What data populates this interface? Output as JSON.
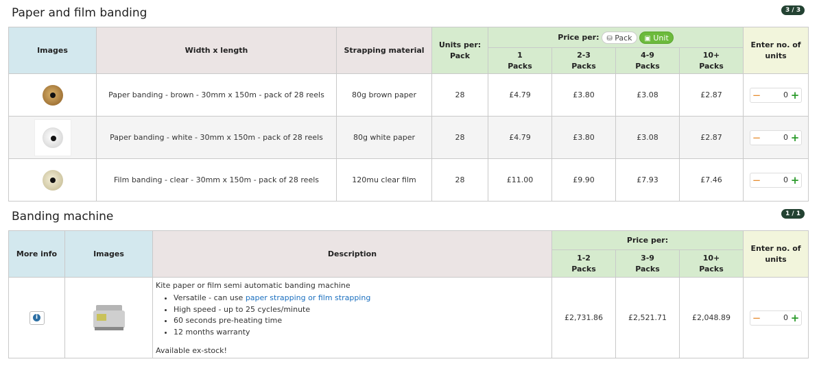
{
  "section1": {
    "title": "Paper and film banding",
    "badge": "3 / 3",
    "headers": {
      "images": "Images",
      "width_length": "Width x length",
      "material": "Strapping material",
      "units_per_pack_1": "Units per:",
      "units_per_pack_2": "Pack",
      "price_per": "Price per:",
      "pack_pill": "Pack",
      "unit_pill": "Unit",
      "tiers": [
        {
          "top": "1",
          "bottom": "Packs"
        },
        {
          "top": "2-3",
          "bottom": "Packs"
        },
        {
          "top": "4-9",
          "bottom": "Packs"
        },
        {
          "top": "10+",
          "bottom": "Packs"
        }
      ],
      "enter_units_1": "Enter no. of",
      "enter_units_2": "units"
    },
    "rows": [
      {
        "image": "brown-reel-image",
        "name": "Paper banding - brown - 30mm x 150m - pack of 28 reels",
        "material": "80g brown paper",
        "units": "28",
        "prices": [
          "£4.79",
          "£3.80",
          "£3.08",
          "£2.87"
        ],
        "qty": "0"
      },
      {
        "image": "white-reel-image",
        "name": "Paper banding - white - 30mm x 150m - pack of 28 reels",
        "material": "80g white paper",
        "units": "28",
        "prices": [
          "£4.79",
          "£3.80",
          "£3.08",
          "£2.87"
        ],
        "qty": "0"
      },
      {
        "image": "clear-reel-image",
        "name": "Film banding - clear - 30mm x 150m - pack of 28 reels",
        "material": "120mu clear film",
        "units": "28",
        "prices": [
          "£11.00",
          "£9.90",
          "£7.93",
          "£7.46"
        ],
        "qty": "0"
      }
    ]
  },
  "section2": {
    "title": "Banding machine",
    "badge": "1 / 1",
    "headers": {
      "more_info": "More info",
      "images": "Images",
      "description": "Description",
      "price_per": "Price per:",
      "tiers": [
        {
          "top": "1-2",
          "bottom": "Packs"
        },
        {
          "top": "3-9",
          "bottom": "Packs"
        },
        {
          "top": "10+",
          "bottom": "Packs"
        }
      ],
      "enter_units_1": "Enter no. of",
      "enter_units_2": "units"
    },
    "row": {
      "desc_title": "Kite paper or film semi automatic banding machine",
      "bullet1_prefix": "Versatile - can use ",
      "bullet1_link": "paper strapping or film strapping",
      "bullet2": "High speed - up to 25 cycles/minute",
      "bullet3": "60 seconds pre-heating time",
      "bullet4": "12 months warranty",
      "stock": "Available ex-stock!",
      "prices": [
        "£2,731.86",
        "£2,521.71",
        "£2,048.89"
      ],
      "qty": "0"
    }
  },
  "controls": {
    "minus": "−",
    "plus": "+",
    "info": "i"
  }
}
